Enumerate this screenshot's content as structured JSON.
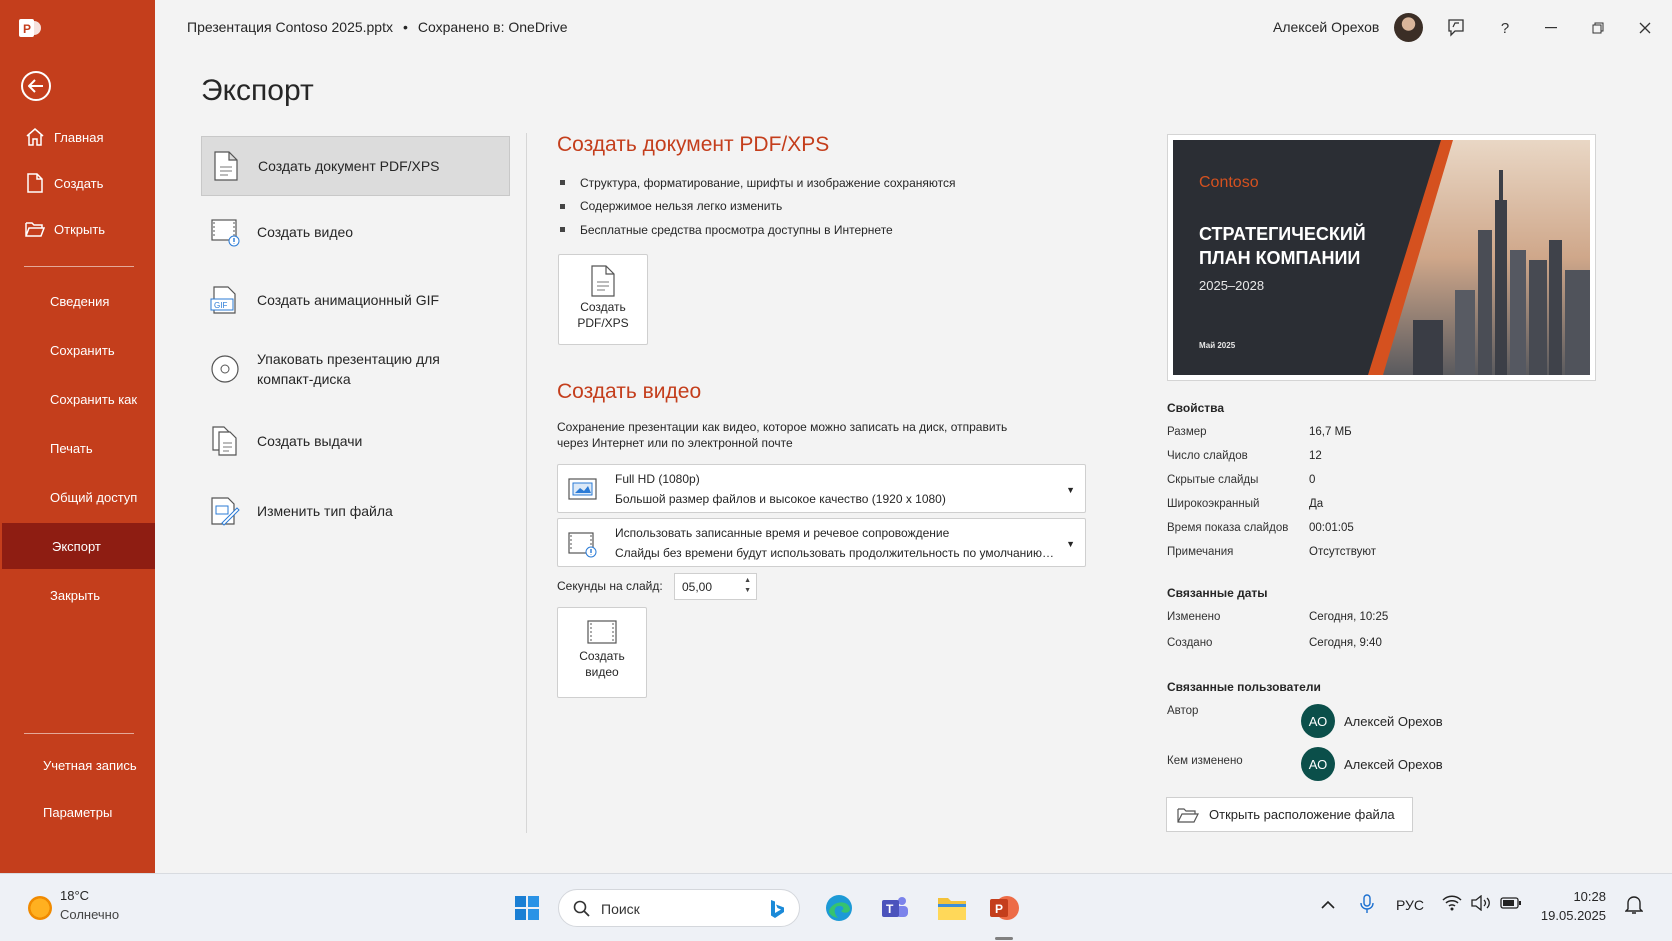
{
  "app": {
    "brand_color": "#c43e1c",
    "active_color": "#8e1d12"
  },
  "titlebar": {
    "file_name": "Презентация Contoso 2025.pptx",
    "separator": "•",
    "save_status": "Сохранено в: OneDrive",
    "user_name": "Алексей Орехов",
    "help": "?"
  },
  "nav": {
    "home": "Главная",
    "new": "Создать",
    "open": "Открыть",
    "info": "Сведения",
    "save": "Сохранить",
    "save_as": "Сохранить как",
    "print": "Печать",
    "share": "Общий доступ",
    "export": "Экспорт",
    "close": "Закрыть",
    "account": "Учетная запись",
    "options": "Параметры"
  },
  "page_title": "Экспорт",
  "export_options": [
    {
      "label": "Создать документ PDF/XPS",
      "selected": true
    },
    {
      "label": "Создать видео"
    },
    {
      "label": "Создать анимационный GIF"
    },
    {
      "label": "Упаковать презентацию для компакт-диска"
    },
    {
      "label": "Создать выдачи"
    },
    {
      "label": "Изменить тип файла"
    }
  ],
  "pdf_section": {
    "title": "Создать документ PDF/XPS",
    "bullets": [
      "Структура, форматирование, шрифты и изображение сохраняются",
      "Содержимое нельзя легко изменить",
      "Бесплатные средства просмотра доступны в Интернете"
    ],
    "button_line1": "Создать",
    "button_line2": "PDF/XPS"
  },
  "video_section": {
    "title": "Создать видео",
    "description": "Сохранение презентации как видео, которое можно записать на диск, отправить через Интернет или по электронной почте",
    "quality": {
      "title": "Full HD (1080p)",
      "subtitle": "Большой размер файлов и высокое качество (1920 x 1080)"
    },
    "timing": {
      "title": "Использовать записанные время и речевое сопровождение",
      "subtitle": "Слайды без времени будут использовать продолжительность по умолчанию (уст..."
    },
    "seconds_label": "Секунды на слайд:",
    "seconds_value": "05,00",
    "button_line1": "Создать",
    "button_line2": "видео"
  },
  "slide_preview": {
    "logo": "Contoso",
    "title": "СТРАТЕГИЧЕСКИЙ ПЛАН КОМПАНИИ",
    "years": "2025–2028",
    "date": "Май 2025"
  },
  "properties": {
    "heading": "Свойства",
    "rows": [
      {
        "label": "Размер",
        "value": "16,7 МБ"
      },
      {
        "label": "Число слайдов",
        "value": "12"
      },
      {
        "label": "Скрытые слайды",
        "value": "0"
      },
      {
        "label": "Широкоэкранный",
        "value": "Да"
      },
      {
        "label": "Время показа слайдов",
        "value": "00:01:05"
      },
      {
        "label": "Примечания",
        "value": "Отсутствуют"
      }
    ]
  },
  "dates": {
    "heading": "Связанные даты",
    "rows": [
      {
        "label": "Изменено",
        "value": "Сегодня, 10:25"
      },
      {
        "label": "Создано",
        "value": "Сегодня, 9:40"
      }
    ]
  },
  "people": {
    "heading": "Связанные пользователи",
    "author_label": "Автор",
    "author_initials": "АО",
    "author_name": "Алексей Орехов",
    "modified_label": "Кем изменено",
    "modified_initials": "АО",
    "modified_name": "Алексей Орехов"
  },
  "open_location": "Открыть расположение файла",
  "taskbar": {
    "temp": "18°C",
    "weather": "Солнечно",
    "search_placeholder": "Поиск",
    "lang": "РУС",
    "time": "10:28",
    "date": "19.05.2025"
  }
}
